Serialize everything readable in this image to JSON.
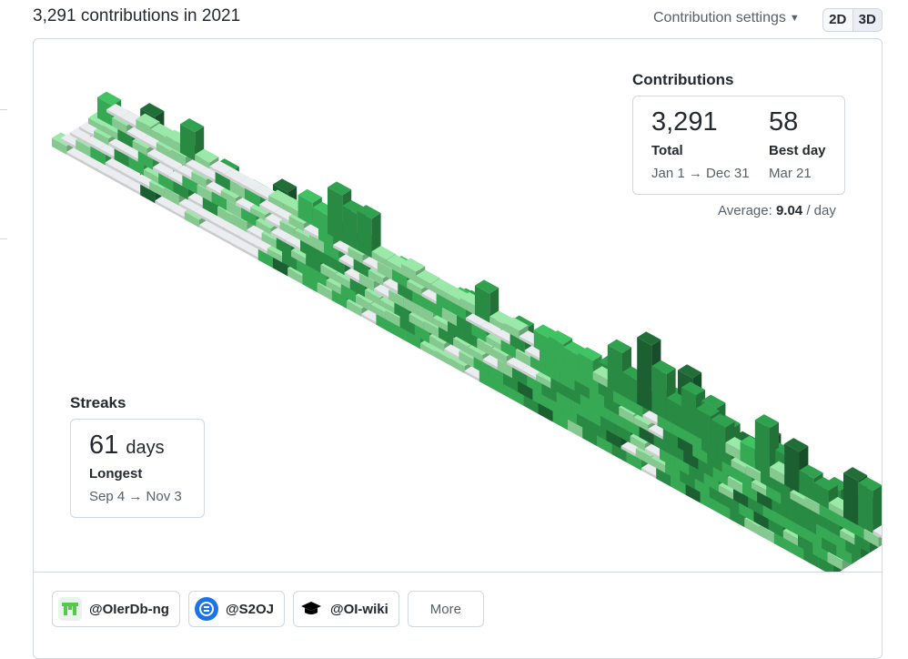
{
  "header": {
    "headline": "3,291 contributions in 2021",
    "settings_label": "Contribution settings",
    "view_2d": "2D",
    "view_3d": "3D"
  },
  "contributions": {
    "title": "Contributions",
    "total_value": "3,291",
    "total_label": "Total",
    "total_range": "Jan 1 → Dec 31",
    "best_value": "58",
    "best_label": "Best day",
    "best_date": "Mar 21",
    "average_prefix": "Average:",
    "average_value": "9.04",
    "average_suffix": "/ day"
  },
  "streaks": {
    "title": "Streaks",
    "longest_value": "61",
    "longest_unit": "days",
    "longest_label": "Longest",
    "longest_range": "Sep 4 → Nov 3"
  },
  "orgs": [
    {
      "name": "@OIerDb-ng",
      "icon": "oierdb-icon"
    },
    {
      "name": "@S2OJ",
      "icon": "s2oj-icon"
    },
    {
      "name": "@OI-wiki",
      "icon": "oi-wiki-icon"
    }
  ],
  "more_label": "More",
  "colors": {
    "empty": "#ebedf0",
    "level1": "#9be9a8",
    "level2": "#40c463",
    "level3": "#30a14e",
    "level4": "#216e39"
  }
}
